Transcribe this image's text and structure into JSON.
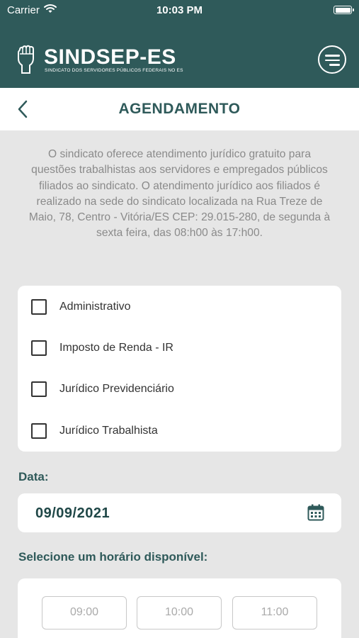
{
  "status_bar": {
    "carrier": "Carrier",
    "time": "10:03 PM"
  },
  "header": {
    "logo_title": "SINDSEP-ES",
    "logo_subtitle": "SINDICATO DOS SERVIDORES PÚBLICOS FEDERAIS NO ES",
    "menu_icon": "menu-circle-icon"
  },
  "nav": {
    "title": "AGENDAMENTO",
    "back_icon": "chevron-left-icon"
  },
  "intro_text": "O sindicato oferece atendimento jurídico gratuito para questões trabalhistas aos servidores e empregados públicos filiados ao sindicato. O atendimento jurídico aos filiados é realizado na sede do sindicato localizada na Rua Treze de Maio, 78, Centro - Vitória/ES CEP: 29.015-280, de segunda à sexta feira, das 08:h00 às 17:h00.",
  "options": [
    {
      "label": "Administrativo",
      "checked": false
    },
    {
      "label": "Imposto de Renda - IR",
      "checked": false
    },
    {
      "label": "Jurídico Previdenciário",
      "checked": false
    },
    {
      "label": "Jurídico Trabalhista",
      "checked": false
    }
  ],
  "date": {
    "label": "Data:",
    "value": "09/09/2021",
    "icon": "calendar-icon"
  },
  "times": {
    "label": "Selecione um horário disponível:",
    "slots": [
      "09:00",
      "10:00",
      "11:00"
    ]
  },
  "colors": {
    "brand": "#2f5a5a",
    "background": "#e6e6e6"
  }
}
